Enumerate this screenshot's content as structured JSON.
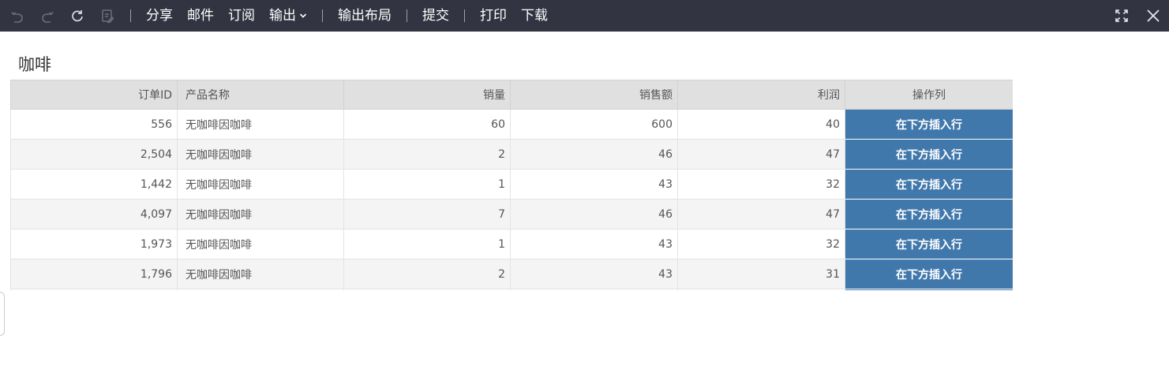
{
  "toolbar": {
    "icons": [
      "undo-icon",
      "redo-icon",
      "refresh-icon",
      "edit-doc-icon"
    ],
    "items": [
      "分享",
      "邮件",
      "订阅",
      "输出",
      "输出布局",
      "提交",
      "打印",
      "下载"
    ],
    "right_icons": [
      "fullscreen-icon",
      "close-icon"
    ]
  },
  "report": {
    "title": "咖啡",
    "columns": [
      "订单ID",
      "产品名称",
      "销量",
      "销售额",
      "利润",
      "操作列"
    ],
    "rows": [
      {
        "id": "556",
        "name": "无咖啡因咖啡",
        "qty": "60",
        "sales": "600",
        "profit": "40",
        "action": "在下方插入行"
      },
      {
        "id": "2,504",
        "name": "无咖啡因咖啡",
        "qty": "2",
        "sales": "46",
        "profit": "47",
        "action": "在下方插入行"
      },
      {
        "id": "1,442",
        "name": "无咖啡因咖啡",
        "qty": "1",
        "sales": "43",
        "profit": "32",
        "action": "在下方插入行"
      },
      {
        "id": "4,097",
        "name": "无咖啡因咖啡",
        "qty": "7",
        "sales": "46",
        "profit": "47",
        "action": "在下方插入行"
      },
      {
        "id": "1,973",
        "name": "无咖啡因咖啡",
        "qty": "1",
        "sales": "43",
        "profit": "32",
        "action": "在下方插入行"
      },
      {
        "id": "1,796",
        "name": "无咖啡因咖啡",
        "qty": "2",
        "sales": "43",
        "profit": "31",
        "action": "在下方插入行"
      }
    ]
  },
  "colors": {
    "toolbar_bg": "#323541",
    "action_button": "#4178ac",
    "header_bg": "#e0e0e0"
  }
}
